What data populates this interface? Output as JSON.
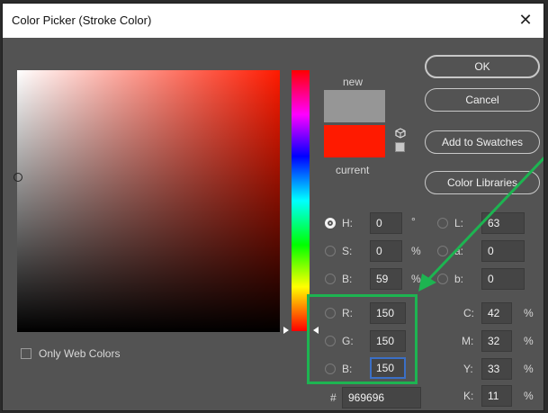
{
  "window": {
    "title": "Color Picker (Stroke Color)"
  },
  "swatch": {
    "new_label": "new",
    "current_label": "current",
    "new_color": "#969696",
    "current_color": "#ff1a00"
  },
  "buttons": {
    "ok": "OK",
    "cancel": "Cancel",
    "add_to_swatches": "Add to Swatches",
    "color_libraries": "Color Libraries"
  },
  "hsb": {
    "h": {
      "label": "H:",
      "value": "0",
      "unit": "°"
    },
    "s": {
      "label": "S:",
      "value": "0",
      "unit": "%"
    },
    "b": {
      "label": "B:",
      "value": "59",
      "unit": "%"
    }
  },
  "lab": {
    "l": {
      "label": "L:",
      "value": "63"
    },
    "a": {
      "label": "a:",
      "value": "0"
    },
    "b": {
      "label": "b:",
      "value": "0"
    }
  },
  "rgb": {
    "r": {
      "label": "R:",
      "value": "150"
    },
    "g": {
      "label": "G:",
      "value": "150"
    },
    "b": {
      "label": "B:",
      "value": "150"
    }
  },
  "cmyk": {
    "c": {
      "label": "C:",
      "value": "42",
      "unit": "%"
    },
    "m": {
      "label": "M:",
      "value": "32",
      "unit": "%"
    },
    "y": {
      "label": "Y:",
      "value": "33",
      "unit": "%"
    },
    "k": {
      "label": "K:",
      "value": "11",
      "unit": "%"
    }
  },
  "hex": {
    "label": "#",
    "value": "969696"
  },
  "options": {
    "only_web_colors": "Only Web Colors"
  },
  "icons": {
    "close": "close-icon",
    "gamut_cube": "cube-icon"
  },
  "annotation": {
    "color": "#1db451"
  }
}
